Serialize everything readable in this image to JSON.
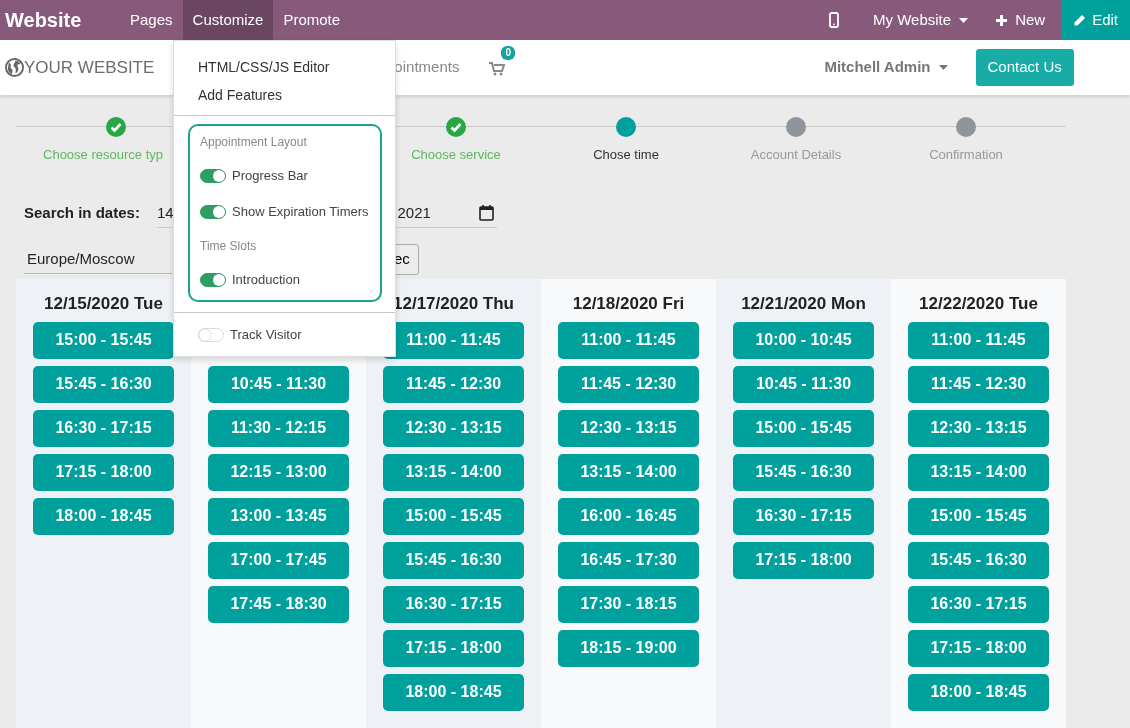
{
  "navbar": {
    "brand": "Website",
    "menu": [
      {
        "label": "Pages",
        "selected": false
      },
      {
        "label": "Customize",
        "selected": true
      },
      {
        "label": "Promote",
        "selected": false
      }
    ],
    "website_switcher": "My Website",
    "new_button": "New",
    "edit_button": "Edit"
  },
  "header": {
    "logo": "YOUR WEBSITE",
    "menu_item": "ointments",
    "cart_count": "0",
    "user": "Mitchell Admin",
    "contact_button": "Contact Us"
  },
  "customize_menu": {
    "items": [
      "HTML/CSS/JS Editor",
      "Add Features"
    ],
    "highlighted_group": [
      {
        "kind": "header",
        "label": "Appointment Layout"
      },
      {
        "kind": "toggle",
        "label": "Progress Bar",
        "on": true
      },
      {
        "kind": "toggle",
        "label": "Show Expiration Timers",
        "on": true
      },
      {
        "kind": "header",
        "label": "Time Slots"
      },
      {
        "kind": "toggle",
        "label": "Introduction",
        "on": true
      }
    ],
    "options": [
      {
        "kind": "toggle",
        "label": "Track Visitor",
        "on": false
      }
    ]
  },
  "steps": [
    {
      "label": "Choose resource typ",
      "done": true,
      "current": false
    },
    {
      "label": "Choose service",
      "done": true,
      "current": false
    },
    {
      "label": "Chose time",
      "done": false,
      "current": true
    },
    {
      "label": "Account Details",
      "done": false,
      "current": false
    },
    {
      "label": "Confirmation",
      "done": false,
      "current": false
    }
  ],
  "search": {
    "label": "Search in dates:",
    "start_date": "14",
    "end_date": "2021"
  },
  "timezone": "Europe/Moscow",
  "month_button": "ec",
  "days": [
    {
      "kind": "full",
      "date": "12/15/2020 Tue",
      "slots": [
        "15:00 - 15:45",
        "15:45 - 16:30",
        "16:30 - 17:15",
        "17:15 - 18:00",
        "18:00 - 18:45"
      ]
    },
    {
      "kind": "partly-covered",
      "slots": [
        "10:45 - 11:30",
        "11:30 - 12:15",
        "12:15 - 13:00",
        "13:00 - 13:45",
        "17:00 - 17:45",
        "17:45 - 18:30"
      ]
    },
    {
      "kind": "full",
      "date": "12/17/2020 Thu",
      "slots": [
        "11:00 - 11:45",
        "11:45 - 12:30",
        "12:30 - 13:15",
        "13:15 - 14:00",
        "15:00 - 15:45",
        "15:45 - 16:30",
        "16:30 - 17:15",
        "17:15 - 18:00",
        "18:00 - 18:45"
      ]
    },
    {
      "kind": "full",
      "date": "12/18/2020 Fri",
      "slots": [
        "11:00 - 11:45",
        "11:45 - 12:30",
        "12:30 - 13:15",
        "13:15 - 14:00",
        "16:00 - 16:45",
        "16:45 - 17:30",
        "17:30 - 18:15",
        "18:15 - 19:00"
      ]
    },
    {
      "kind": "full",
      "date": "12/21/2020 Mon",
      "slots": [
        "10:00 - 10:45",
        "10:45 - 11:30",
        "15:00 - 15:45",
        "15:45 - 16:30",
        "16:30 - 17:15",
        "17:15 - 18:00"
      ]
    },
    {
      "kind": "full",
      "date": "12/22/2020 Tue",
      "slots": [
        "11:00 - 11:45",
        "11:45 - 12:30",
        "12:30 - 13:15",
        "13:15 - 14:00",
        "15:00 - 15:45",
        "15:45 - 16:30",
        "16:30 - 17:15",
        "17:15 - 18:00",
        "18:00 - 18:45"
      ]
    }
  ]
}
